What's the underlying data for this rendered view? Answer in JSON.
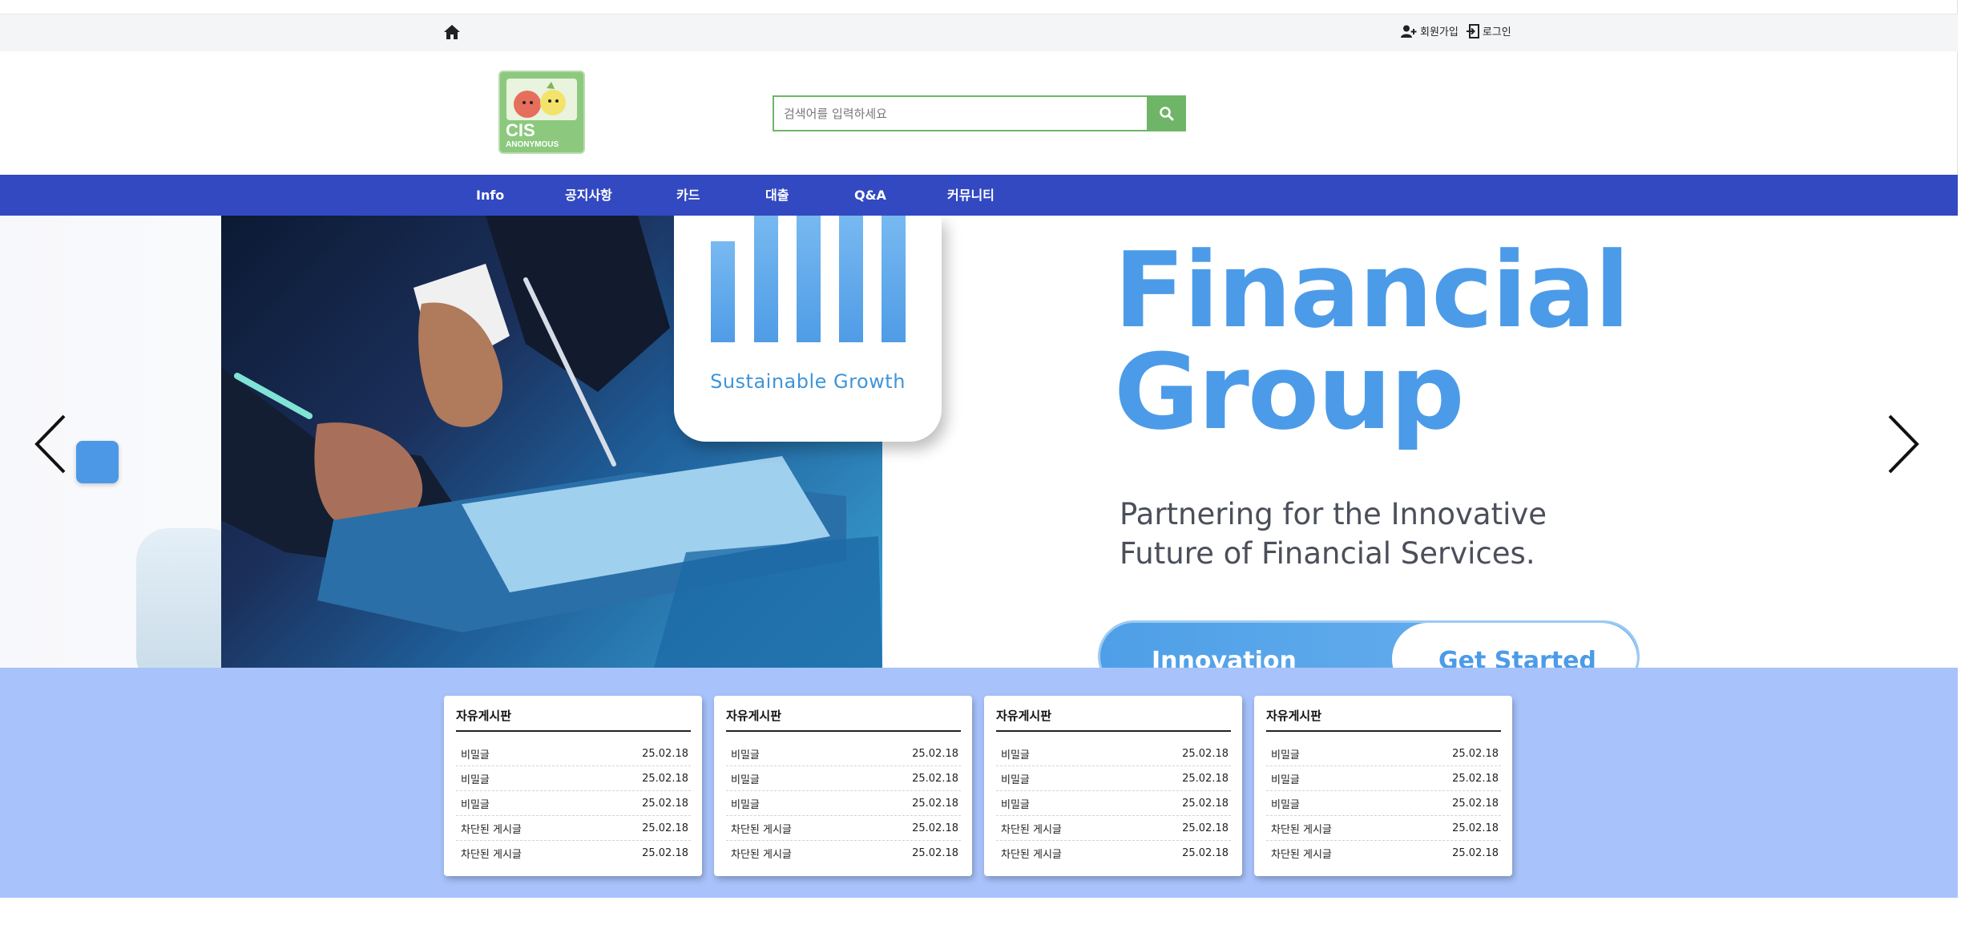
{
  "topbar": {
    "home_icon": "home-icon",
    "signup_label": "회원가입",
    "login_label": "로그인"
  },
  "header": {
    "logo_text_big": "CIS",
    "logo_text_small": "ANONYMOUS",
    "search_placeholder": "검색어를 입력하세요",
    "search_icon": "search-icon"
  },
  "nav": {
    "items": [
      "Info",
      "공지사항",
      "카드",
      "대출",
      "Q&A",
      "커뮤니티"
    ]
  },
  "hero": {
    "growth_label": "Sustainable Growth",
    "headline_1": "Financial",
    "headline_2": "Group",
    "tagline_1": "Partnering for the Innovative",
    "tagline_2": "Future of Financial Services.",
    "pill_left": "Innovation",
    "pill_right": "Get Started"
  },
  "boards": [
    {
      "title": "자유게시판",
      "rows": [
        {
          "title": "비밀글",
          "date": "25.02.18"
        },
        {
          "title": "비밀글",
          "date": "25.02.18"
        },
        {
          "title": "비밀글",
          "date": "25.02.18"
        },
        {
          "title": "차단된 게시글",
          "date": "25.02.18"
        },
        {
          "title": "차단된 게시글",
          "date": "25.02.18"
        }
      ]
    },
    {
      "title": "자유게시판",
      "rows": [
        {
          "title": "비밀글",
          "date": "25.02.18"
        },
        {
          "title": "비밀글",
          "date": "25.02.18"
        },
        {
          "title": "비밀글",
          "date": "25.02.18"
        },
        {
          "title": "차단된 게시글",
          "date": "25.02.18"
        },
        {
          "title": "차단된 게시글",
          "date": "25.02.18"
        }
      ]
    },
    {
      "title": "자유게시판",
      "rows": [
        {
          "title": "비밀글",
          "date": "25.02.18"
        },
        {
          "title": "비밀글",
          "date": "25.02.18"
        },
        {
          "title": "비밀글",
          "date": "25.02.18"
        },
        {
          "title": "차단된 게시글",
          "date": "25.02.18"
        },
        {
          "title": "차단된 게시글",
          "date": "25.02.18"
        }
      ]
    },
    {
      "title": "자유게시판",
      "rows": [
        {
          "title": "비밀글",
          "date": "25.02.18"
        },
        {
          "title": "비밀글",
          "date": "25.02.18"
        },
        {
          "title": "비밀글",
          "date": "25.02.18"
        },
        {
          "title": "차단된 게시글",
          "date": "25.02.18"
        },
        {
          "title": "차단된 게시글",
          "date": "25.02.18"
        }
      ]
    }
  ],
  "colors": {
    "nav_bg": "#3249c1",
    "accent_green": "#6fb567",
    "hero_blue": "#4c9be8",
    "boards_bg": "#a8c2fb"
  }
}
